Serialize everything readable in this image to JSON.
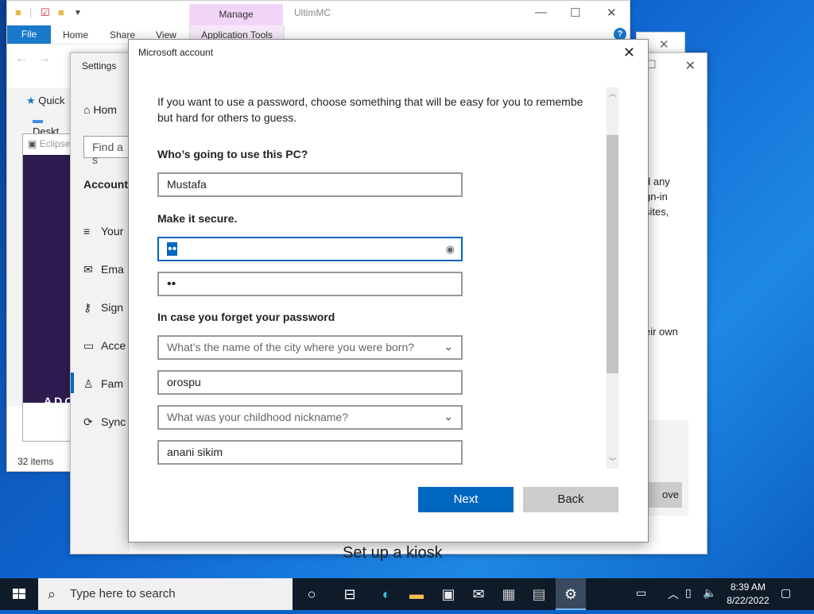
{
  "explorer": {
    "title": "UltimMC",
    "manage_tab": "Manage",
    "tabs": [
      "File",
      "Home",
      "Share",
      "View"
    ],
    "app_tools": "Application Tools",
    "tree": [
      "Quick",
      "Deskt"
    ],
    "status": "32 items"
  },
  "eclipse": {
    "title": "Eclipse",
    "banner": "ADO"
  },
  "settings": {
    "title": "Settings",
    "home": "Hom",
    "find_placeholder": "Find a s",
    "section": "Accounts",
    "nav": [
      "Your",
      "Ema",
      "Sign",
      "Acce",
      "Fam",
      "Sync"
    ],
    "kiosk": "Set up a kiosk",
    "side_text": [
      "d any",
      "gn-in",
      "sites,",
      "eir own"
    ],
    "remove": "ove"
  },
  "dialog": {
    "title": "Microsoft account",
    "intro_line1": "If you want to use a password, choose something that will be easy for you to remembe",
    "intro_line2": "but hard for others to guess.",
    "who_label": "Who’s going to use this PC?",
    "username": "Mustafa",
    "secure_label": "Make it secure.",
    "password_dots": "••",
    "confirm_dots": "••",
    "forget_label": "In case you forget your password",
    "q1": "What’s the name of the city where you were born?",
    "a1": "orospu",
    "q2": "What was your childhood nickname?",
    "a2": "anani sikim",
    "next": "Next",
    "back": "Back"
  },
  "taskbar": {
    "search_placeholder": "Type here to search",
    "time": "8:39 AM",
    "date": "8/22/2022"
  },
  "colors": {
    "accent": "#0067c0",
    "taskbar": "#101b2a"
  }
}
